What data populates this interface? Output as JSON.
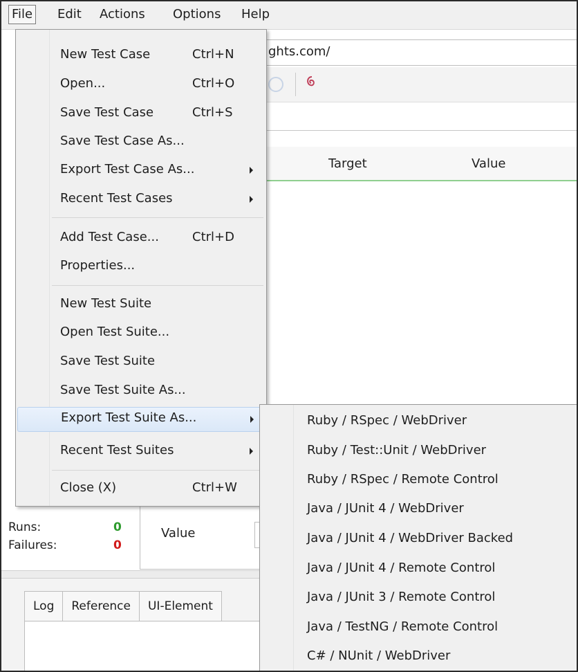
{
  "menubar": {
    "file": "File",
    "edit": "Edit",
    "actions": "Actions",
    "options": "Options",
    "help": "Help"
  },
  "url_fragment": "ghts.com/",
  "grid_headers": {
    "target": "Target",
    "value": "Value"
  },
  "stats": {
    "runs_label": "Runs:",
    "runs_value": "0",
    "failures_label": "Failures:",
    "failures_value": "0",
    "runs_color": "#2e9b2e",
    "failures_color": "#d11a1a"
  },
  "properties": {
    "value_label": "Value"
  },
  "bottom_tabs": [
    "Log",
    "Reference",
    "UI-Element"
  ],
  "file_menu": {
    "items": [
      {
        "label": "New Test Case",
        "shortcut": "Ctrl+N"
      },
      {
        "label": "Open...",
        "shortcut": "Ctrl+O"
      },
      {
        "label": "Save Test Case",
        "shortcut": "Ctrl+S"
      },
      {
        "label": "Save Test Case As...",
        "shortcut": ""
      },
      {
        "label": "Export Test Case As...",
        "shortcut": ""
      },
      {
        "label": "Recent Test Cases",
        "shortcut": ""
      },
      {
        "label": "Add Test Case...",
        "shortcut": "Ctrl+D"
      },
      {
        "label": "Properties...",
        "shortcut": ""
      },
      {
        "label": "New Test Suite",
        "shortcut": ""
      },
      {
        "label": "Open Test Suite...",
        "shortcut": ""
      },
      {
        "label": "Save Test Suite",
        "shortcut": ""
      },
      {
        "label": "Save Test Suite As...",
        "shortcut": ""
      },
      {
        "label": "Export Test Suite As...",
        "shortcut": ""
      },
      {
        "label": "Recent Test Suites",
        "shortcut": ""
      },
      {
        "label": "Close (X)",
        "shortcut": "Ctrl+W"
      }
    ]
  },
  "export_submenu": {
    "items": [
      "Ruby / RSpec / WebDriver",
      "Ruby / Test::Unit / WebDriver",
      "Ruby / RSpec / Remote Control",
      "Java / JUnit 4 / WebDriver",
      "Java / JUnit 4 / WebDriver Backed",
      "Java / JUnit 4 / Remote Control",
      "Java / JUnit 3 / Remote Control",
      "Java / TestNG / Remote Control",
      "C# / NUnit / WebDriver"
    ]
  }
}
